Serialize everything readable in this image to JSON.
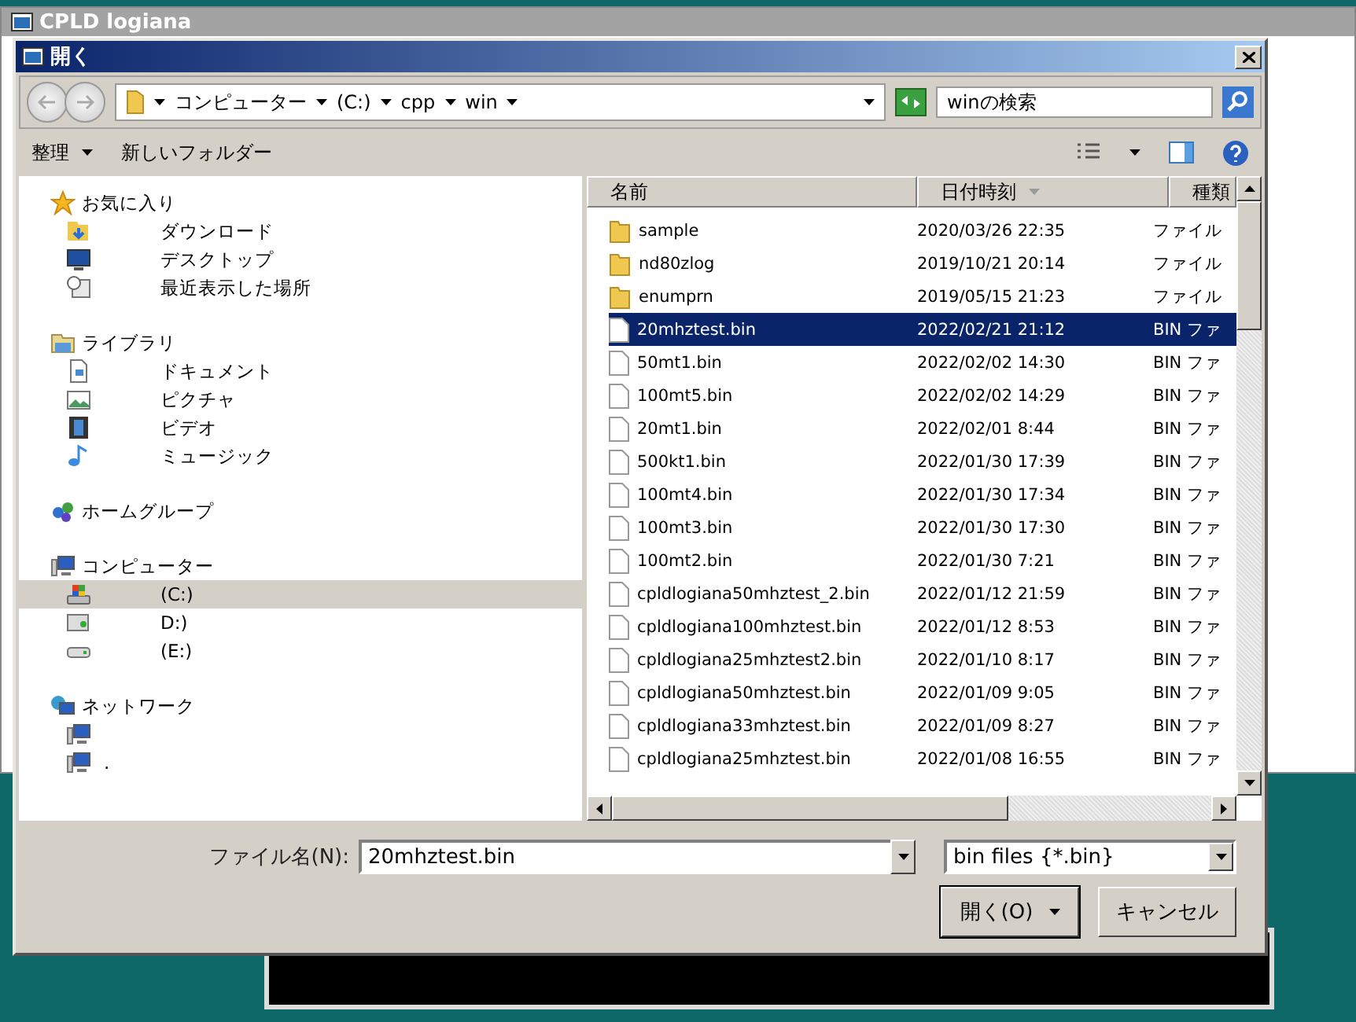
{
  "parent_window": {
    "title": "CPLD logiana"
  },
  "dialog": {
    "title": "開く",
    "breadcrumb": [
      "コンピューター",
      "(C:)",
      "cpp",
      "win"
    ],
    "search": {
      "placeholder": "winの検索"
    },
    "toolbar": [
      {
        "label": "整理",
        "kind": "menu"
      },
      {
        "label": "新しいフォルダー",
        "kind": "plain"
      }
    ],
    "sidebar": [
      {
        "label": "お気に入り",
        "kind": "star",
        "selected": false,
        "children": [
          {
            "label": "ダウンロード",
            "kind": "download",
            "selected": false
          },
          {
            "label": "デスクトップ",
            "kind": "desktop",
            "selected": false
          },
          {
            "label": "最近表示した場所",
            "kind": "recent",
            "selected": false
          }
        ]
      },
      {
        "label": "ライブラリ",
        "kind": "library",
        "selected": false,
        "children": [
          {
            "label": "ドキュメント",
            "kind": "document",
            "selected": false
          },
          {
            "label": "ピクチャ",
            "kind": "picture",
            "selected": false
          },
          {
            "label": "ビデオ",
            "kind": "video",
            "selected": false
          },
          {
            "label": "ミュージック",
            "kind": "music",
            "selected": false
          }
        ]
      },
      {
        "label": "ホームグループ",
        "kind": "homegroup",
        "selected": false
      },
      {
        "label": "コンピューター",
        "kind": "computer",
        "selected": false,
        "children": [
          {
            "label": "(C:)",
            "kind": "system",
            "selected": true
          },
          {
            "label": "D:)",
            "kind": "dvd",
            "selected": false
          },
          {
            "label": "(E:)",
            "kind": "drive",
            "selected": false
          }
        ]
      },
      {
        "label": "ネットワーク",
        "kind": "network",
        "selected": false,
        "children": [
          {
            "kind": "pc",
            "selected": false
          },
          {
            "label": ".",
            "kind": "pc",
            "selected": false
          }
        ]
      }
    ],
    "table": {
      "columns": [
        {
          "label": "名前",
          "sorted": false
        },
        {
          "label": "日付時刻",
          "sorted": true
        },
        {
          "label": "種類",
          "sorted": false
        }
      ],
      "rows": [
        {
          "kind": "folder",
          "name": "sample",
          "date": "2020/03/26 22:35",
          "type": "ファイル",
          "selected": false
        },
        {
          "kind": "folder",
          "name": "nd80zlog",
          "date": "2019/10/21 20:14",
          "type": "ファイル",
          "selected": false
        },
        {
          "kind": "folder",
          "name": "enumprn",
          "date": "2019/05/15 21:23",
          "type": "ファイル",
          "selected": false
        },
        {
          "kind": "file",
          "name": "20mhztest.bin",
          "date": "2022/02/21 21:12",
          "type": "BIN ファ",
          "selected": true
        },
        {
          "kind": "file",
          "name": "50mt1.bin",
          "date": "2022/02/02 14:30",
          "type": "BIN ファ",
          "selected": false
        },
        {
          "kind": "file",
          "name": "100mt5.bin",
          "date": "2022/02/02 14:29",
          "type": "BIN ファ",
          "selected": false
        },
        {
          "kind": "file",
          "name": "20mt1.bin",
          "date": "2022/02/01 8:44",
          "type": "BIN ファ",
          "selected": false
        },
        {
          "kind": "file",
          "name": "500kt1.bin",
          "date": "2022/01/30 17:39",
          "type": "BIN ファ",
          "selected": false
        },
        {
          "kind": "file",
          "name": "100mt4.bin",
          "date": "2022/01/30 17:34",
          "type": "BIN ファ",
          "selected": false
        },
        {
          "kind": "file",
          "name": "100mt3.bin",
          "date": "2022/01/30 17:30",
          "type": "BIN ファ",
          "selected": false
        },
        {
          "kind": "file",
          "name": "100mt2.bin",
          "date": "2022/01/30 7:21",
          "type": "BIN ファ",
          "selected": false
        },
        {
          "kind": "file",
          "name": "cpldlogiana50mhztest_2.bin",
          "date": "2022/01/12 21:59",
          "type": "BIN ファ",
          "selected": false
        },
        {
          "kind": "file",
          "name": "cpldlogiana100mhztest.bin",
          "date": "2022/01/12 8:53",
          "type": "BIN ファ",
          "selected": false
        },
        {
          "kind": "file",
          "name": "cpldlogiana25mhztest2.bin",
          "date": "2022/01/10 8:17",
          "type": "BIN ファ",
          "selected": false
        },
        {
          "kind": "file",
          "name": "cpldlogiana50mhztest.bin",
          "date": "2022/01/09 9:05",
          "type": "BIN ファ",
          "selected": false
        },
        {
          "kind": "file",
          "name": "cpldlogiana33mhztest.bin",
          "date": "2022/01/09 8:27",
          "type": "BIN ファ",
          "selected": false
        },
        {
          "kind": "file",
          "name": "cpldlogiana25mhztest.bin",
          "date": "2022/01/08 16:55",
          "type": "BIN ファ",
          "selected": false
        }
      ]
    },
    "filename": {
      "label": "ファイル名(N):",
      "value": "20mhztest.bin"
    },
    "filter": {
      "value": "bin files {*.bin}"
    },
    "buttons": [
      {
        "label": "開く(O)",
        "kind": "split"
      },
      {
        "label": "キャンセル",
        "kind": "plain"
      }
    ]
  }
}
